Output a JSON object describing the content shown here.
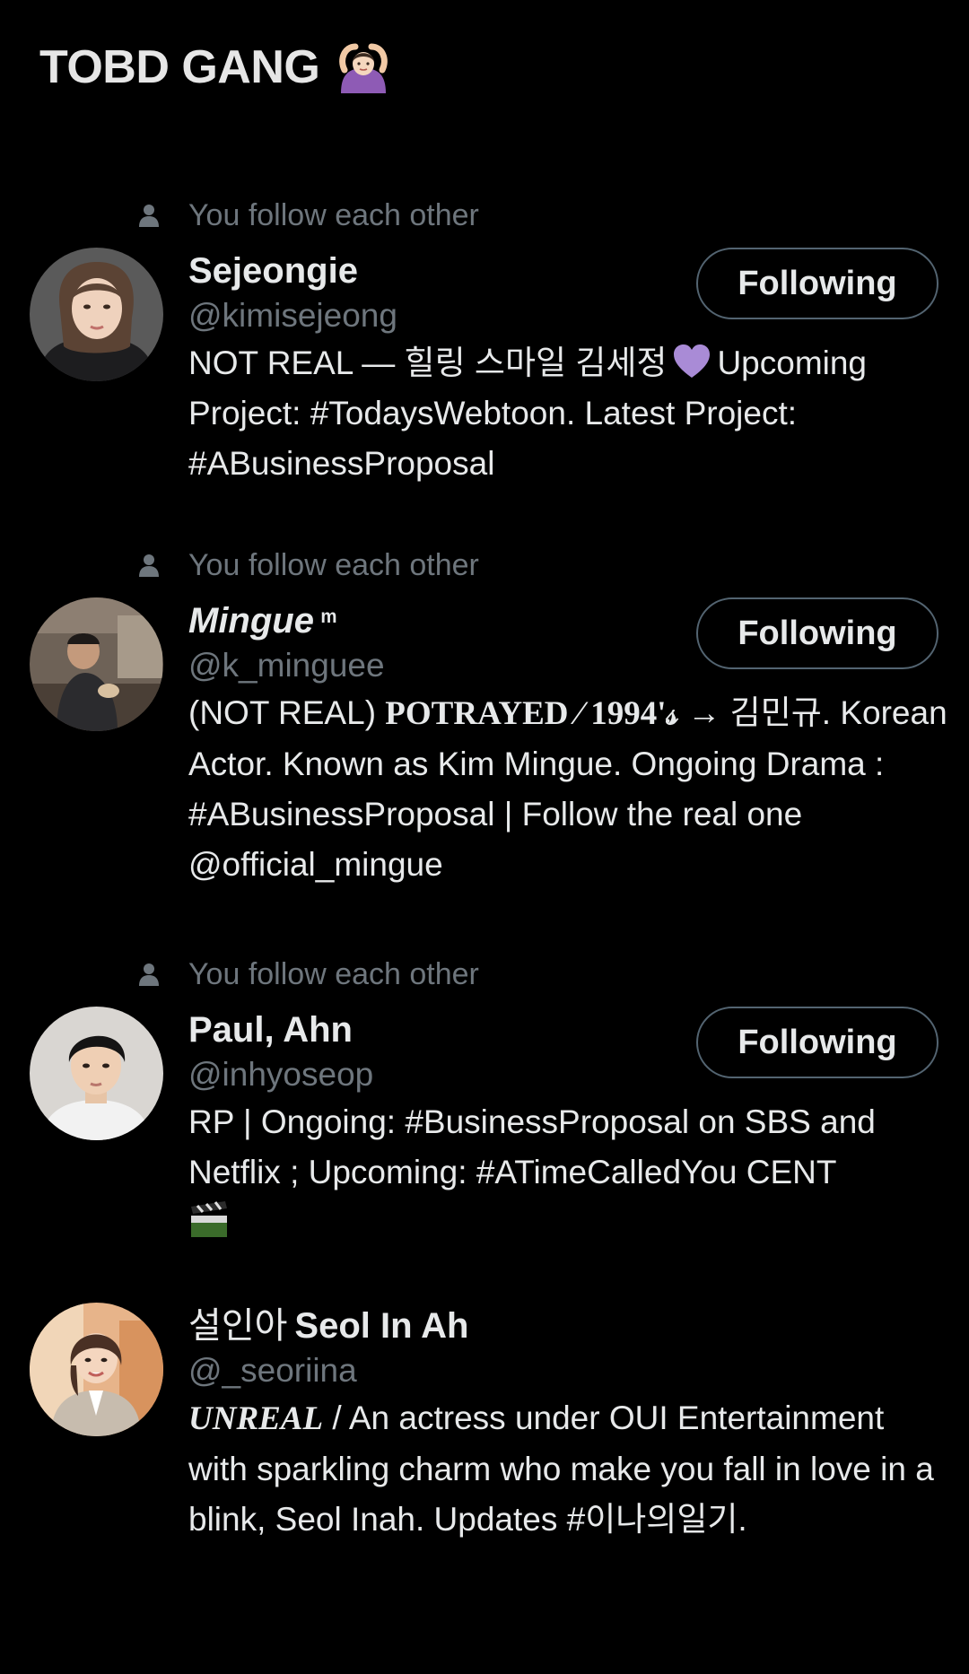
{
  "header": {
    "title": "TOBD GANG",
    "title_emoji": "person-gesturing-ok-emoji"
  },
  "users": [
    {
      "context": "You follow each other",
      "name": "Sejeongie",
      "handle": "@kimisejeong",
      "button": "Following",
      "bio_part1": "NOT REAL — 힐링 스마일 김세정",
      "bio_part2": "Upcoming Project: #TodaysWebtoon. Latest Project: #ABusinessProposal",
      "bio_emoji": "purple-heart-emoji"
    },
    {
      "context": "You follow each other",
      "name": "Mingue",
      "name_suffix": "ᵐ",
      "handle": "@k_minguee",
      "button": "Following",
      "bio_part1": "(NOT REAL)",
      "bio_part2": "POTRAYED ⁄ 1994'𝓈",
      "bio_part3": "→ 김민규. Korean Actor. Known as Kim Mingue. Ongoing Drama : #ABusinessProposal | Follow the real one @official_mingue"
    },
    {
      "context": "You follow each other",
      "name": "Paul, Ahn",
      "handle": "@inhyoseop",
      "button": "Following",
      "bio_part1": "RP | Ongoing: #BusinessProposal on SBS and Netflix ; Upcoming: #ATimeCalledYou CENT",
      "bio_emoji": "clapper-board-emoji"
    },
    {
      "name_korean": "설인아",
      "name": "Seol In Ah",
      "handle": "@_seoriina",
      "bio_part1": "UNREAL",
      "bio_part2": "/ An actress under OUI Entertainment with sparkling charm who make you fall in love in a blink, Seol Inah. Updates #이나의일기."
    }
  ],
  "colors": {
    "background": "#000000",
    "secondary_text": "#6e767d",
    "primary_text": "#e7e9ea",
    "button_border": "#536471",
    "heart": "#a98bd6"
  }
}
